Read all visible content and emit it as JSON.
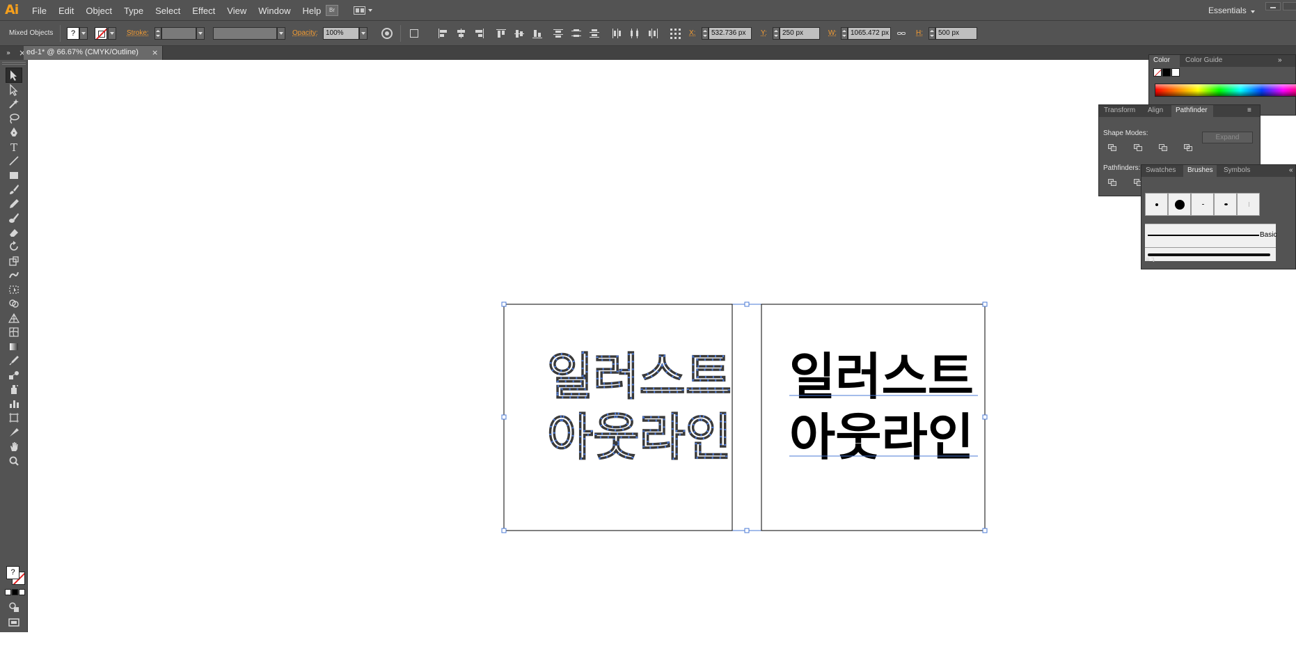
{
  "app": {
    "logo": "Ai"
  },
  "menu": [
    "File",
    "Edit",
    "Object",
    "Type",
    "Select",
    "Effect",
    "View",
    "Window",
    "Help"
  ],
  "bridge_button": {
    "label": "Br"
  },
  "workspace": {
    "label": "Essentials"
  },
  "control": {
    "selection": "Mixed Objects",
    "fill_value": "?",
    "stroke_label": "Stroke:",
    "opacity_label": "Opacity:",
    "opacity_value": "100%",
    "x_label": "X:",
    "x_value": "532.736 px",
    "y_label": "Y:",
    "y_value": "250 px",
    "w_label": "W:",
    "w_value": "1065.472 px",
    "h_label": "H:",
    "h_value": "500 px"
  },
  "document": {
    "tab_label": "ed-1* @ 66.67% (CMYK/Outline)",
    "close_label": "×"
  },
  "tools": {
    "fill_value": "?",
    "list": [
      "selection",
      "direct-selection",
      "magic-wand",
      "lasso",
      "pen",
      "type",
      "line-segment",
      "rectangle",
      "paintbrush",
      "pencil",
      "blob-brush",
      "eraser",
      "rotate",
      "scale",
      "warp",
      "free-transform",
      "shape-builder",
      "perspective-grid",
      "mesh",
      "gradient",
      "eyedropper",
      "blend",
      "symbol-sprayer",
      "column-graph",
      "artboard",
      "slice",
      "hand",
      "zoom"
    ]
  },
  "artwork": {
    "left_text": [
      "일러스트",
      "아웃라인"
    ],
    "right_text": [
      "일러스트",
      "아웃라인"
    ],
    "selection_color": "#4a78d6"
  },
  "panels": {
    "color": {
      "tabs": [
        "Color",
        "Color Guide"
      ]
    },
    "pathfinder": {
      "tabs": [
        "Transform",
        "Align",
        "Pathfinder"
      ],
      "shape_modes_label": "Shape Modes:",
      "pathfinders_label": "Pathfinders:",
      "expand_label": "Expand"
    },
    "brushes": {
      "tabs": [
        "Swatches",
        "Brushes",
        "Symbols"
      ],
      "basic_label": "Basic"
    }
  },
  "colors": {
    "chrome": "#535353",
    "dark": "#3f3f3f",
    "accent_orange": "#f39c33",
    "selection_blue": "#4a78d6"
  }
}
